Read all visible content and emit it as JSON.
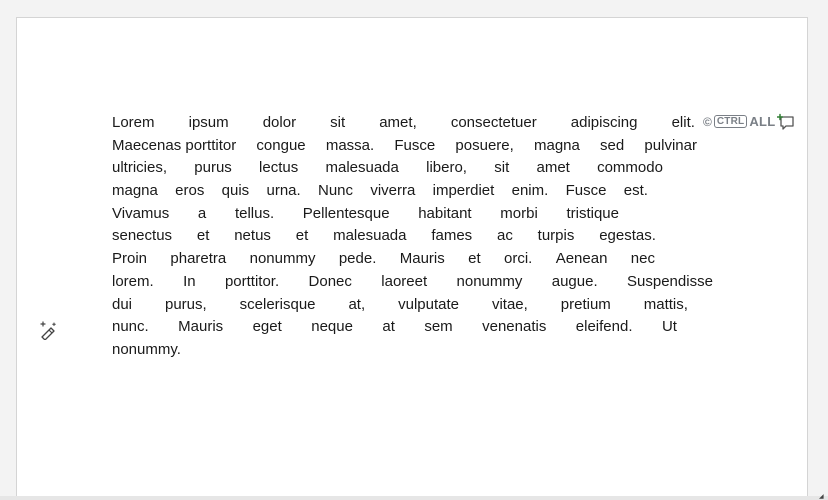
{
  "document": {
    "lines": [
      [
        "Lorem",
        "ipsum",
        "dolor",
        "sit",
        "amet,",
        "consectetuer",
        "adipiscing",
        "elit."
      ],
      [
        "Maecenas porttitor",
        "congue",
        "massa.",
        "Fusce",
        "posuere,",
        "magna",
        "sed",
        "pulvinar"
      ],
      [
        "ultricies,",
        "purus",
        "lectus",
        "malesuada",
        "libero,",
        "sit",
        "amet",
        "commodo"
      ],
      [
        "magna",
        "eros",
        "quis",
        "urna.",
        "Nunc",
        "viverra",
        "imperdiet",
        "enim.",
        "Fusce",
        "est."
      ],
      [
        "Vivamus",
        "a",
        "tellus.",
        "Pellentesque",
        "habitant",
        "morbi",
        "tristique"
      ],
      [
        "senectus",
        "et",
        "netus",
        "et",
        "malesuada",
        "fames",
        "ac",
        "turpis",
        "egestas."
      ],
      [
        "Proin",
        "pharetra",
        "nonummy",
        "pede.",
        "Mauris",
        "et",
        "orci.",
        "Aenean",
        "nec"
      ],
      [
        "lorem.",
        "In",
        "porttitor.",
        "Donec",
        "laoreet",
        "nonummy",
        "augue.",
        "Suspendisse"
      ],
      [
        "dui",
        "purus,",
        "scelerisque",
        "at,",
        "vulputate",
        "vitae,",
        "pretium",
        "mattis,"
      ],
      [
        "nunc.",
        "Mauris",
        "eget",
        "neque",
        "at",
        "sem",
        "venenatis",
        "eleifend.",
        "Ut"
      ],
      [
        "nonummy."
      ]
    ]
  },
  "ctrl_all_badge": {
    "copy_glyph": "©",
    "ctrl_label": "CTRL",
    "all_label": "ALL"
  },
  "icons": {
    "comment": "comment-add-icon",
    "wand": "magic-wand-icon"
  },
  "colors": {
    "text": "#1a1a1a",
    "badge": "#7a7f86",
    "comment_accent": "#2e7d32"
  }
}
